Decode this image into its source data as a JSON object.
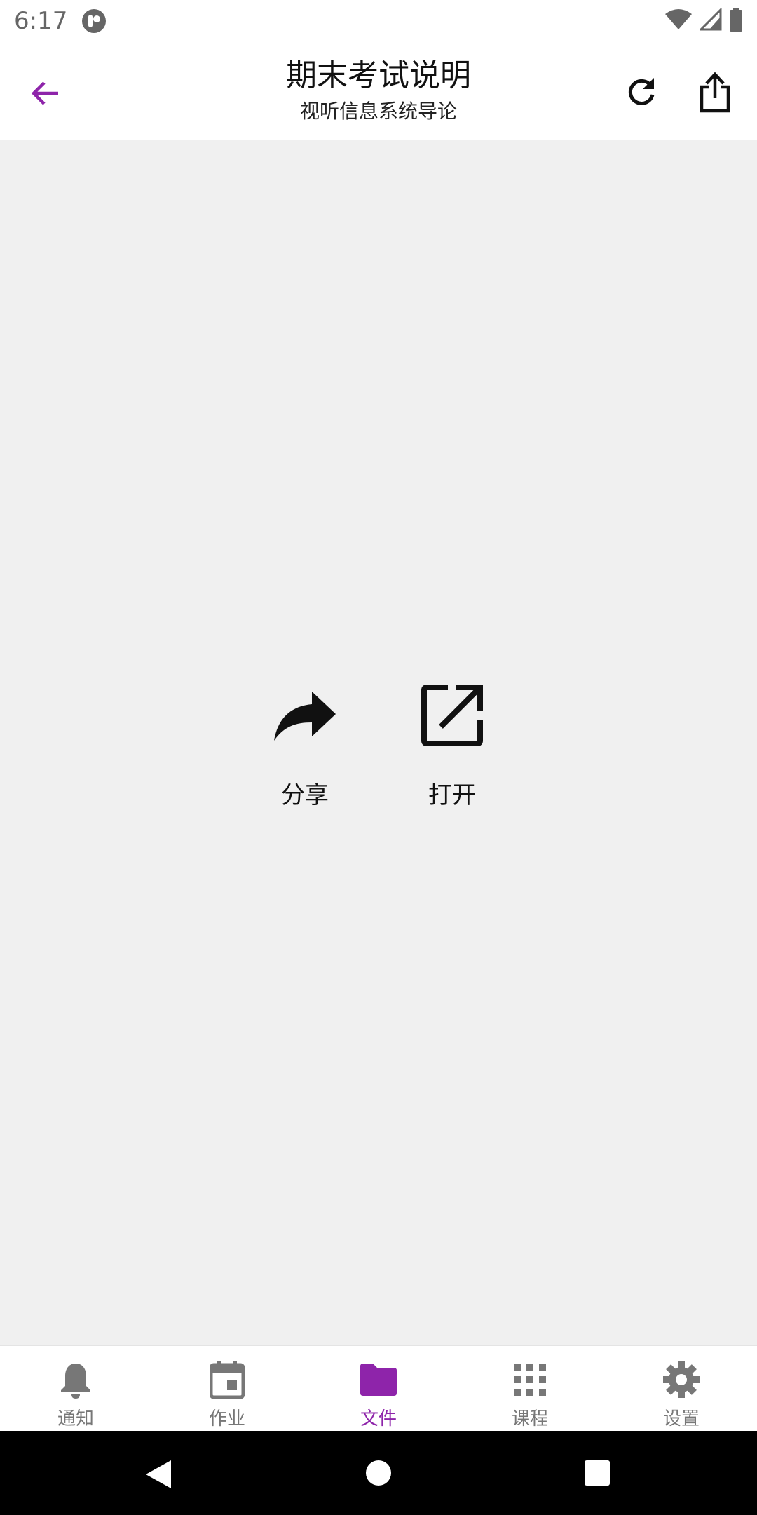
{
  "status_bar": {
    "time": "6:17"
  },
  "app_bar": {
    "title": "期末考试说明",
    "subtitle": "视听信息系统导论"
  },
  "actions": {
    "share_label": "分享",
    "open_label": "打开"
  },
  "bottom_nav": {
    "items": [
      {
        "label": "通知",
        "icon": "bell-icon"
      },
      {
        "label": "作业",
        "icon": "calendar-icon"
      },
      {
        "label": "文件",
        "icon": "folder-icon",
        "active": true
      },
      {
        "label": "课程",
        "icon": "grid-icon"
      },
      {
        "label": "设置",
        "icon": "gear-icon"
      }
    ]
  },
  "colors": {
    "accent": "#8e24aa",
    "inactive": "#777777",
    "background": "#f0f0f0"
  }
}
